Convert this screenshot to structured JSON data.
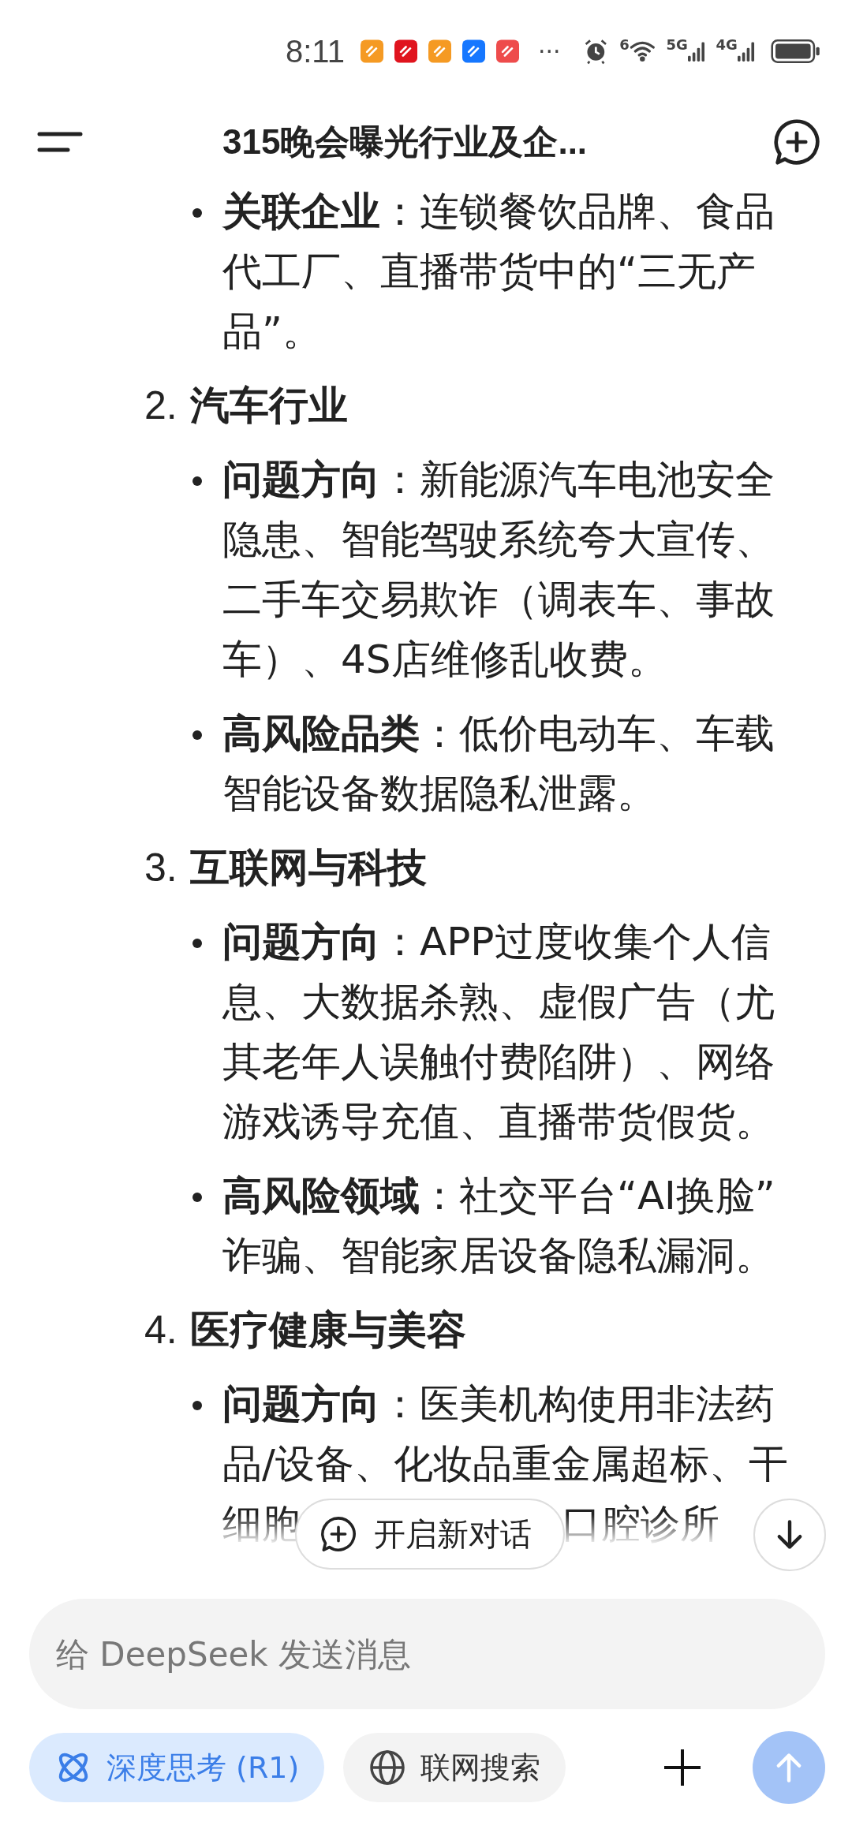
{
  "status_bar": {
    "time": "8:11",
    "notification_apps": [
      {
        "color": "#f59a23"
      },
      {
        "color": "#e0141e"
      },
      {
        "color": "#f59a23"
      },
      {
        "color": "#1677ff"
      },
      {
        "color": "#ee4c4c"
      }
    ],
    "more": "···",
    "wifi_label": "6",
    "networks": [
      "5G",
      "4G"
    ]
  },
  "header": {
    "title": "315晚会曝光行业及企..."
  },
  "continued_bullets": [
    {
      "label": "关联企业",
      "text": "：连锁餐饮品牌、食品代工厂、直播带货中的“三无产品”。"
    }
  ],
  "sections": [
    {
      "number": "2.",
      "title": "汽车行业",
      "bullets": [
        {
          "label": "问题方向",
          "text": "：新能源汽车电池安全隐患、智能驾驶系统夸大宣传、二手车交易欺诈（调表车、事故车）、4S店维修乱收费。"
        },
        {
          "label": "高风险品类",
          "text": "：低价电动车、车载智能设备数据隐私泄露。"
        }
      ]
    },
    {
      "number": "3.",
      "title": "互联网与科技",
      "bullets": [
        {
          "label": "问题方向",
          "text": "：APP过度收集个人信息、大数据杀熟、虚假广告（尤其老年人误触付费陷阱）、网络游戏诱导充值、直播带货假货。"
        },
        {
          "label": "高风险领域",
          "text": "：社交平台“AI换脸”诈骗、智能家居设备隐私漏洞。"
        }
      ]
    },
    {
      "number": "4.",
      "title": "医疗健康与美容",
      "bullets": [
        {
          "label": "问题方向",
          "text": "：医美机构使用非法药品/设备、化妆品重金属超标、干",
          "partly_covered_line": [
            "细胞",
            "口腔诊所"
          ]
        }
      ]
    }
  ],
  "new_chat_button": {
    "label": "开启新对话"
  },
  "composer": {
    "placeholder": "给 DeepSeek 发送消息",
    "chips": [
      {
        "kind": "deep-think",
        "label": "深度思考 (R1)",
        "selected": true
      },
      {
        "kind": "web-search",
        "label": "联网搜索",
        "selected": false
      }
    ],
    "send_disabled": true
  }
}
